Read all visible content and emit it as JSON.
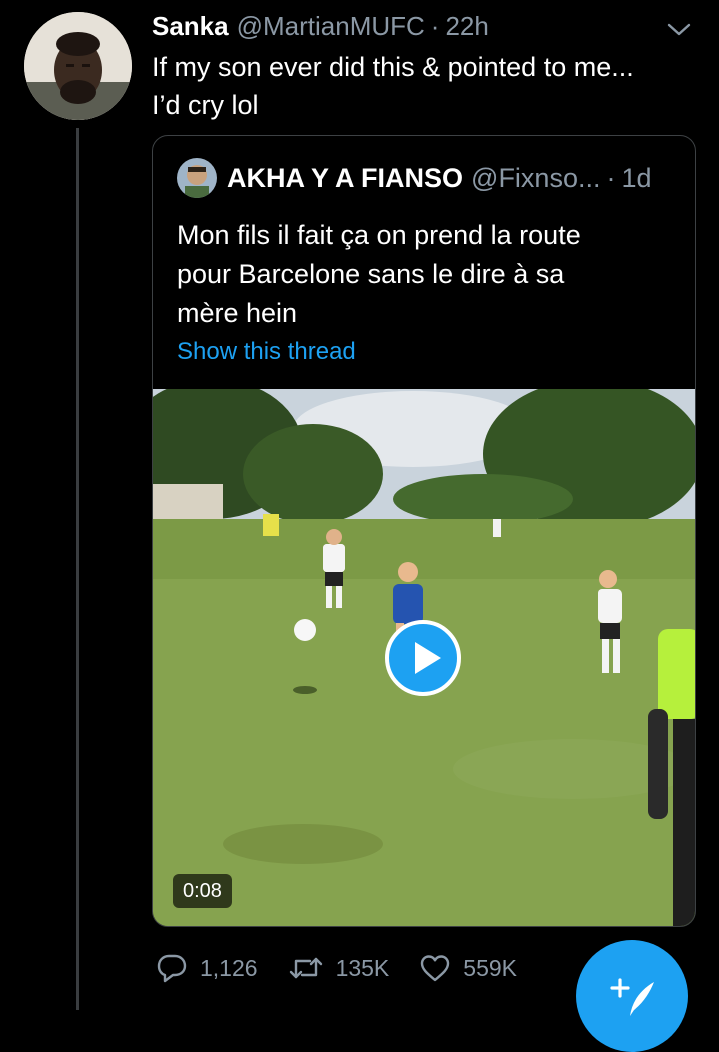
{
  "tweet": {
    "author_name": "Sanka",
    "author_handle": "@MartianMUFC",
    "separator": "·",
    "time": "22h",
    "text_lines": [
      "If my son ever did this & pointed to me...",
      "I’d cry lol"
    ]
  },
  "quote": {
    "author_name": "AKHA Y A FIANSO",
    "author_handle": "@Fixnso...",
    "separator": "·",
    "time": "1d",
    "text_lines": [
      "Mon fils il fait ça on prend la route",
      "pour Barcelone sans le dire à sa",
      "mère hein"
    ],
    "show_thread_label": "Show this thread",
    "video_duration": "0:08"
  },
  "actions": {
    "replies": "1,126",
    "retweets": "135K",
    "likes": "559K"
  },
  "icons": [
    "chevron-down-icon",
    "reply-icon",
    "retweet-icon",
    "like-icon",
    "play-icon",
    "compose-tweet-icon"
  ],
  "colors": {
    "background": "#000000",
    "accent": "#1da1f2",
    "secondary_text": "#8b98a5",
    "border": "#3d4144"
  }
}
